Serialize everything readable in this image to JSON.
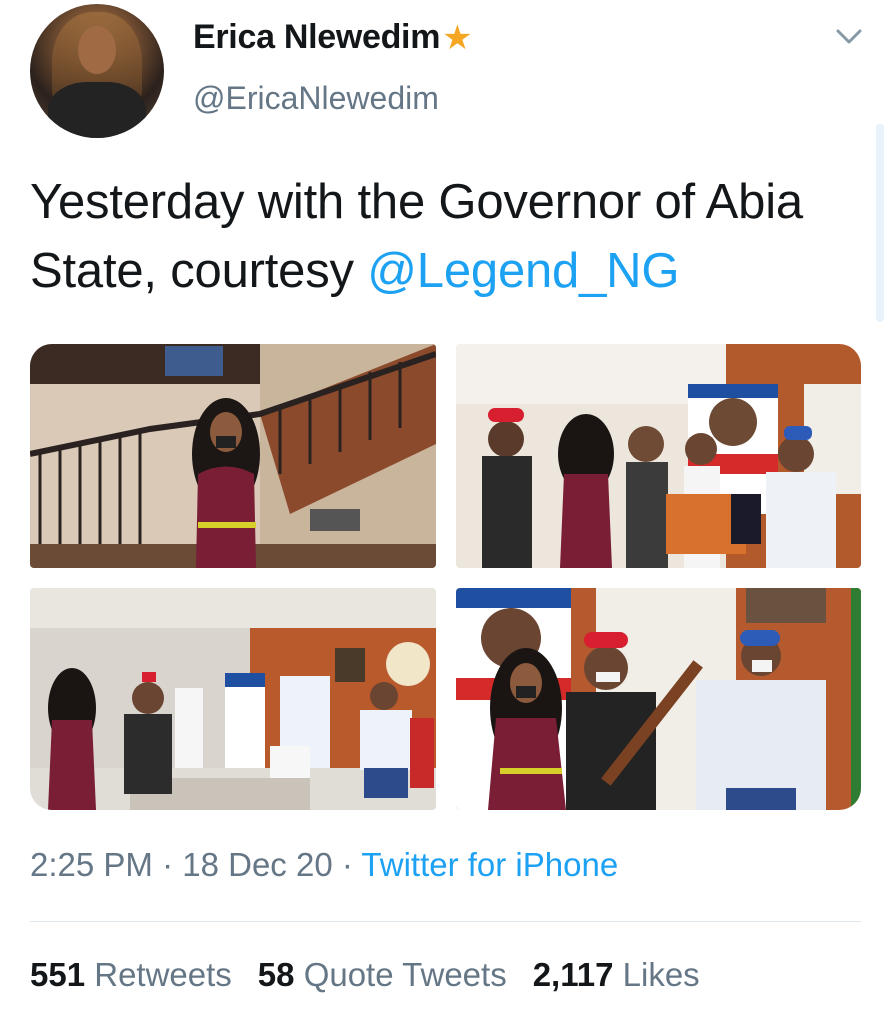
{
  "author": {
    "display_name": "Erica Nlewedim",
    "verified_icon": "star-icon",
    "handle": "@EricaNlewedim"
  },
  "tweet": {
    "text_prefix": "Yesterday with the Governor of Abia State, courtesy ",
    "mention": "@Legend_NG"
  },
  "photos": [
    {
      "name": "photo-staircase"
    },
    {
      "name": "photo-presentation"
    },
    {
      "name": "photo-office"
    },
    {
      "name": "photo-staff-handover"
    }
  ],
  "meta": {
    "time": "2:25 PM",
    "separator": " · ",
    "date": "18 Dec 20",
    "source": "Twitter for iPhone"
  },
  "stats": {
    "retweets_count": "551",
    "retweets_label": "Retweets",
    "quotes_count": "58",
    "quotes_label": "Quote Tweets",
    "likes_count": "2,117",
    "likes_label": "Likes"
  },
  "colors": {
    "accent": "#1da1f2",
    "secondary_text": "#657786",
    "star": "#f5a623"
  }
}
